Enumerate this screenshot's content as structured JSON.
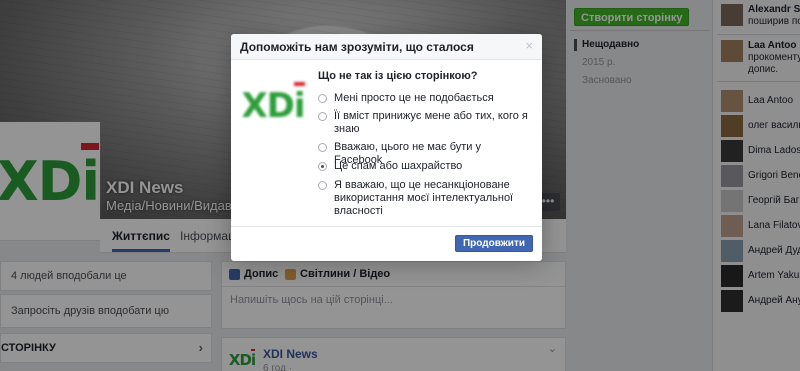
{
  "page": {
    "name": "XDI News",
    "category": "Медіа/Новини/Видав",
    "tabs": [
      "Життєпис",
      "Інформаці"
    ],
    "likes_text": "4 людей вподобали це",
    "invite_text": "Запросіть друзів вподобати цю сторінку",
    "section_label": "СТОРІНКУ",
    "composer": {
      "tab_post": "Допис",
      "tab_media": "Світлини / Відео",
      "placeholder": "Напишіть щось на цій сторінці..."
    },
    "post": {
      "author": "XDI News",
      "time": "6 год ·"
    },
    "logo_text": "XDi"
  },
  "right_column": {
    "create_button": "Створити сторінку",
    "timeline": [
      "Нещодавно",
      "2015 р.",
      "Засновано"
    ],
    "selected_index": 0
  },
  "sidebar": {
    "activity": [
      {
        "name": "Alexandr Shu",
        "action": "поширив пос",
        "avatar_color": "#7a6a5a"
      },
      {
        "name": "Laa Antoo",
        "action": "прокоментув допис.",
        "avatar_color": "#a08060"
      }
    ],
    "contacts": [
      {
        "name": "Laa Antoo",
        "avatar_color": "#b09070"
      },
      {
        "name": "олег васильє",
        "avatar_color": "#8a6a40"
      },
      {
        "name": "Dima Ladosh",
        "avatar_color": "#3a3a3a"
      },
      {
        "name": "Grigori Benco",
        "avatar_color": "#9a9aa0"
      },
      {
        "name": "Георгій Багр",
        "avatar_color": "#c8c8c8"
      },
      {
        "name": "Lana Filatova",
        "avatar_color": "#c0a090"
      },
      {
        "name": "Андрей Дудо",
        "avatar_color": "#8aa0b0"
      },
      {
        "name": "Artem Yakush",
        "avatar_color": "#2a2a2a"
      },
      {
        "name": "Андрей Ануф",
        "avatar_color": "#303030"
      }
    ]
  },
  "dialog": {
    "title": "Допоможіть нам зрозуміти, що сталося",
    "close": "×",
    "question": "Що не так із цією сторінкою?",
    "options": [
      "Мені просто це не подобається",
      "Її вміст принижує мене або тих, кого я знаю",
      "Вважаю, цього не має бути у Facebook",
      "Це спам або шахрайство",
      "Я вважаю, що це несанкціоноване використання моєї інтелектуальної власності"
    ],
    "selected_option": 3,
    "continue_button": "Продовжити"
  },
  "colors": {
    "brand_green": "#2e9e3a",
    "brand_red": "#d8262e",
    "fb_blue": "#4267b2",
    "create_green": "#42b72a"
  }
}
